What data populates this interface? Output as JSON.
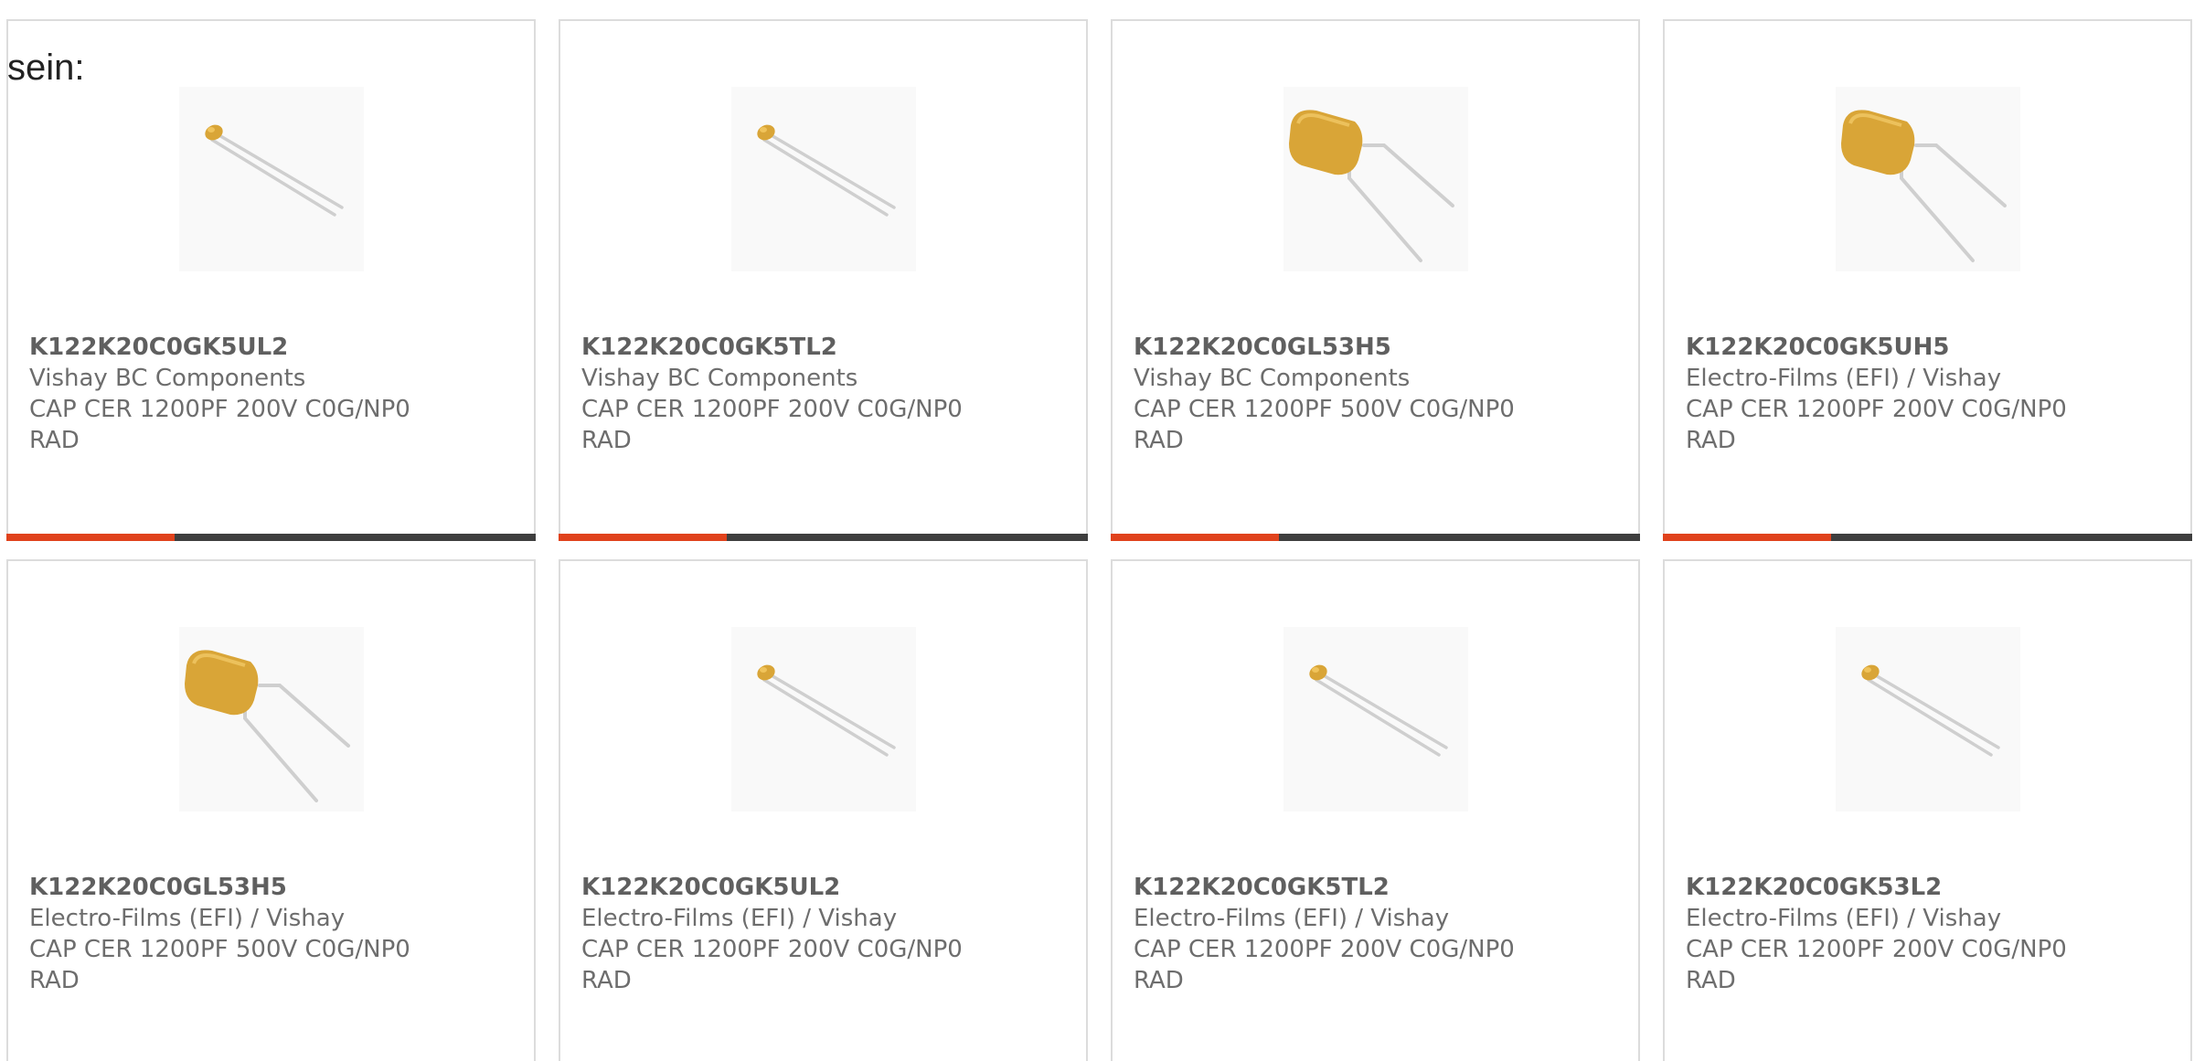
{
  "intro_text": "sein:",
  "colors": {
    "accent": "#e0421c",
    "bar_dark": "#3e3e3e",
    "capacitor_body": "#d9a537",
    "lead_wire": "#cfcfcf"
  },
  "products": [
    {
      "part": "K122K20C0GK5UL2",
      "manufacturer": "Vishay BC Components",
      "description": "CAP CER 1200PF 200V C0G/NP0",
      "package": "RAD",
      "image_icon": "small-disc-capacitor-icon",
      "bar": true
    },
    {
      "part": "K122K20C0GK5TL2",
      "manufacturer": "Vishay BC Components",
      "description": "CAP CER 1200PF 200V C0G/NP0",
      "package": "RAD",
      "image_icon": "small-disc-capacitor-icon",
      "bar": true
    },
    {
      "part": "K122K20C0GL53H5",
      "manufacturer": "Vishay BC Components",
      "description": "CAP CER 1200PF 500V C0G/NP0",
      "package": "RAD",
      "image_icon": "large-block-capacitor-icon",
      "bar": true
    },
    {
      "part": "K122K20C0GK5UH5",
      "manufacturer": "Electro-Films (EFI) / Vishay",
      "description": "CAP CER 1200PF 200V C0G/NP0",
      "package": "RAD",
      "image_icon": "large-block-capacitor-icon",
      "bar": true
    },
    {
      "part": "K122K20C0GL53H5",
      "manufacturer": "Electro-Films (EFI) / Vishay",
      "description": "CAP CER 1200PF 500V C0G/NP0",
      "package": "RAD",
      "image_icon": "large-block-capacitor-icon",
      "bar": false
    },
    {
      "part": "K122K20C0GK5UL2",
      "manufacturer": "Electro-Films (EFI) / Vishay",
      "description": "CAP CER 1200PF 200V C0G/NP0",
      "package": "RAD",
      "image_icon": "small-disc-capacitor-icon",
      "bar": false
    },
    {
      "part": "K122K20C0GK5TL2",
      "manufacturer": "Electro-Films (EFI) / Vishay",
      "description": "CAP CER 1200PF 200V C0G/NP0",
      "package": "RAD",
      "image_icon": "small-disc-capacitor-icon",
      "bar": false
    },
    {
      "part": "K122K20C0GK53L2",
      "manufacturer": "Electro-Films (EFI) / Vishay",
      "description": "CAP CER 1200PF 200V C0G/NP0",
      "package": "RAD",
      "image_icon": "small-disc-capacitor-icon",
      "bar": false
    }
  ]
}
